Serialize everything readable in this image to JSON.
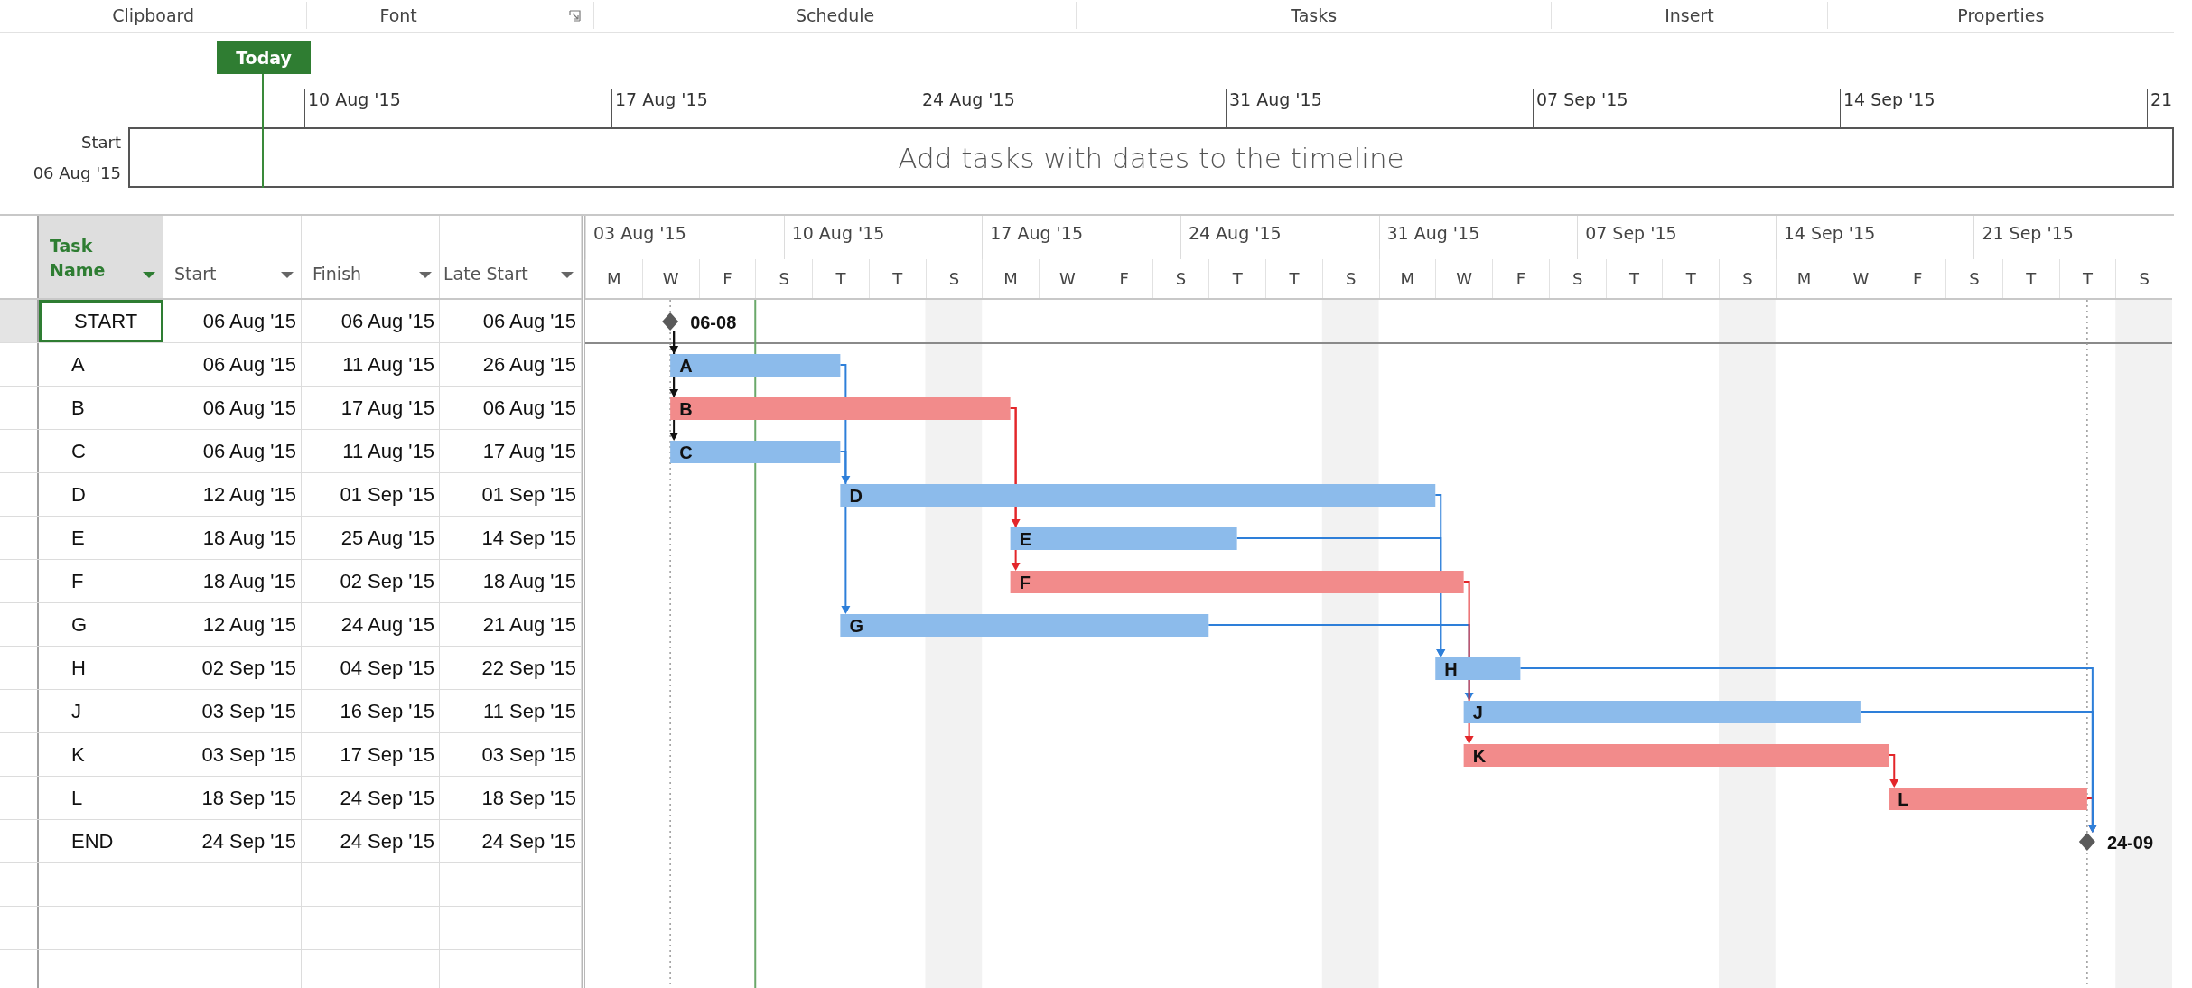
{
  "ribbon_groups": [
    {
      "label": "Clipboard",
      "launcher": false
    },
    {
      "label": "Font",
      "launcher": true
    },
    {
      "label": "Schedule",
      "launcher": false
    },
    {
      "label": "Tasks",
      "launcher": false
    },
    {
      "label": "Insert",
      "launcher": false
    },
    {
      "label": "Properties",
      "launcher": false
    }
  ],
  "timeline": {
    "today_label": "Today",
    "start_label": "Start",
    "start_date": "06 Aug '15",
    "ticks": [
      "10 Aug '15",
      "17 Aug '15",
      "24 Aug '15",
      "31 Aug '15",
      "07 Sep '15",
      "14 Sep '15",
      "21"
    ],
    "placeholder": "Add tasks with dates to the timeline"
  },
  "table": {
    "columns": [
      {
        "label": "Task Name",
        "selected": true
      },
      {
        "label": "Start",
        "selected": false
      },
      {
        "label": "Finish",
        "selected": false
      },
      {
        "label": "Late Start",
        "selected": false
      }
    ]
  },
  "tasks": [
    {
      "name": "START",
      "start": "06 Aug '15",
      "finish": "06 Aug '15",
      "late_start": "06 Aug '15",
      "kind": "milestone",
      "bar_label": "06-08",
      "selected": true
    },
    {
      "name": "A",
      "start": "06 Aug '15",
      "finish": "11 Aug '15",
      "late_start": "26 Aug '15",
      "kind": "task",
      "critical": false,
      "bar_label": "A",
      "selected": false,
      "predecessors_above": [
        true
      ]
    },
    {
      "name": "B",
      "start": "06 Aug '15",
      "finish": "17 Aug '15",
      "late_start": "06 Aug '15",
      "kind": "task",
      "critical": true,
      "bar_label": "B",
      "selected": false,
      "predecessors_above": [
        false,
        true
      ]
    },
    {
      "name": "C",
      "start": "06 Aug '15",
      "finish": "11 Aug '15",
      "late_start": "17 Aug '15",
      "kind": "task",
      "critical": false,
      "bar_label": "C",
      "selected": false,
      "predecessors_above": [
        false,
        false,
        true
      ]
    },
    {
      "name": "D",
      "start": "12 Aug '15",
      "finish": "01 Sep '15",
      "late_start": "01 Sep '15",
      "kind": "task",
      "critical": false,
      "bar_label": "D",
      "selected": false,
      "predecessors_above": [
        false,
        false,
        true
      ]
    },
    {
      "name": "E",
      "start": "18 Aug '15",
      "finish": "25 Aug '15",
      "late_start": "14 Sep '15",
      "kind": "task",
      "critical": false,
      "bar_label": "E",
      "selected": false,
      "predecessors_above": [
        false,
        false,
        true
      ]
    },
    {
      "name": "F",
      "start": "18 Aug '15",
      "finish": "02 Sep '15",
      "late_start": "18 Aug '15",
      "kind": "task",
      "critical": true,
      "bar_label": "F",
      "selected": false,
      "predecessors_above": [
        false,
        false,
        false,
        true
      ]
    },
    {
      "name": "G",
      "start": "12 Aug '15",
      "finish": "24 Aug '15",
      "late_start": "21 Aug '15",
      "kind": "task",
      "critical": false,
      "bar_label": "G",
      "selected": false,
      "predecessors_above": [
        false,
        false,
        false,
        true
      ]
    },
    {
      "name": "H",
      "start": "02 Sep '15",
      "finish": "04 Sep '15",
      "late_start": "22 Sep '15",
      "kind": "task",
      "critical": false,
      "bar_label": "H",
      "selected": false,
      "predecessors_above": [
        false,
        false,
        true,
        true
      ]
    },
    {
      "name": "J",
      "start": "03 Sep '15",
      "finish": "16 Sep '15",
      "late_start": "11 Sep '15",
      "kind": "task",
      "critical": false,
      "bar_label": "J",
      "selected": false,
      "predecessors_above": [
        false,
        true
      ]
    },
    {
      "name": "K",
      "start": "03 Sep '15",
      "finish": "17 Sep '15",
      "late_start": "03 Sep '15",
      "kind": "task",
      "critical": true,
      "bar_label": "K",
      "selected": false,
      "predecessors_above": [
        false,
        false,
        false,
        true
      ]
    },
    {
      "name": "L",
      "start": "18 Sep '15",
      "finish": "24 Sep '15",
      "late_start": "18 Sep '15",
      "kind": "task",
      "critical": true,
      "bar_label": "L",
      "selected": false,
      "predecessors_above": [
        true
      ]
    },
    {
      "name": "END",
      "start": "24 Sep '15",
      "finish": "24 Sep '15",
      "late_start": "24 Sep '15",
      "kind": "milestone",
      "bar_label": "24-09",
      "selected": false,
      "predecessors_above": [
        true,
        false,
        true,
        true
      ]
    }
  ],
  "timescale": {
    "weeks": [
      "03 Aug '15",
      "10 Aug '15",
      "17 Aug '15",
      "24 Aug '15",
      "31 Aug '15",
      "07 Sep '15",
      "14 Sep '15",
      "21 Sep '15"
    ],
    "days": [
      {
        "label": "M",
        "shaded": false
      },
      {
        "label": "W",
        "shaded": false
      },
      {
        "label": "F",
        "shaded": false
      },
      {
        "label": "S",
        "shaded": false
      },
      {
        "label": "T",
        "shaded": false
      },
      {
        "label": "T",
        "shaded": false
      },
      {
        "label": "S",
        "shaded": true
      },
      {
        "label": "M",
        "shaded": false
      },
      {
        "label": "W",
        "shaded": false
      },
      {
        "label": "F",
        "shaded": false
      },
      {
        "label": "S",
        "shaded": false
      },
      {
        "label": "T",
        "shaded": false
      },
      {
        "label": "T",
        "shaded": false
      },
      {
        "label": "S",
        "shaded": true
      },
      {
        "label": "M",
        "shaded": false
      },
      {
        "label": "W",
        "shaded": false
      },
      {
        "label": "F",
        "shaded": false
      },
      {
        "label": "S",
        "shaded": false
      },
      {
        "label": "T",
        "shaded": false
      },
      {
        "label": "T",
        "shaded": false
      },
      {
        "label": "S",
        "shaded": true
      },
      {
        "label": "M",
        "shaded": false
      },
      {
        "label": "W",
        "shaded": false
      },
      {
        "label": "F",
        "shaded": false
      },
      {
        "label": "S",
        "shaded": false
      },
      {
        "label": "T",
        "shaded": false
      },
      {
        "label": "T",
        "shaded": false
      },
      {
        "label": "S",
        "shaded": true
      }
    ]
  }
}
